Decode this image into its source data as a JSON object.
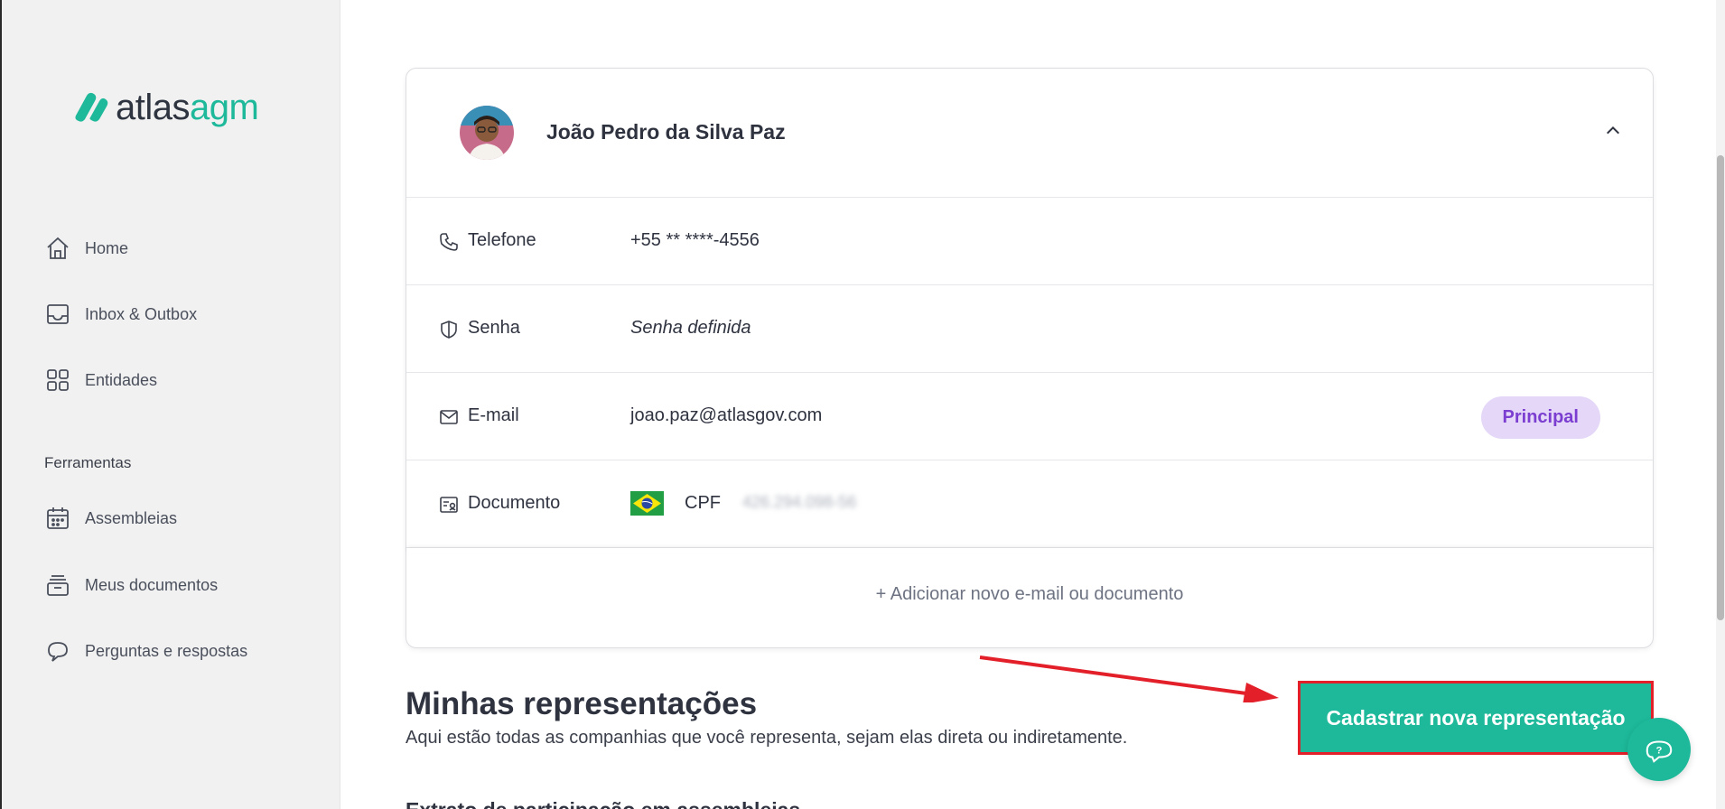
{
  "brand": {
    "word1": "atlas",
    "word2": "agm",
    "accent": "#1db99a"
  },
  "sidebar": {
    "items": [
      {
        "label": "Home",
        "icon": "home-icon"
      },
      {
        "label": "Inbox & Outbox",
        "icon": "inbox-icon"
      },
      {
        "label": "Entidades",
        "icon": "grid-icon"
      }
    ],
    "section_label": "Ferramentas",
    "tools": [
      {
        "label": "Assembleias",
        "icon": "calendar-icon"
      },
      {
        "label": "Meus documentos",
        "icon": "archive-icon"
      },
      {
        "label": "Perguntas e respostas",
        "icon": "chat-icon"
      }
    ]
  },
  "profile": {
    "name": "João Pedro da Silva Paz",
    "rows": {
      "phone": {
        "label": "Telefone",
        "value": "+55 ** ****-4556"
      },
      "password": {
        "label": "Senha",
        "value": "Senha definida"
      },
      "email": {
        "label": "E-mail",
        "value": "joao.paz@atlasgov.com",
        "badge": "Principal"
      },
      "document": {
        "label": "Documento",
        "type": "CPF",
        "value": "426.294.098-56"
      }
    },
    "add_link": "+ Adicionar novo e-mail ou documento"
  },
  "representations": {
    "title": "Minhas representações",
    "subtitle": "Aqui estão todas as companhias que você representa, sejam elas direta ou indiretamente.",
    "cta_label": "Cadastrar nova representação",
    "next_heading": "Extrato de participação em assembleias"
  },
  "colors": {
    "badge_bg": "#e4d7f8",
    "badge_text": "#7b3ed0",
    "annotation_red": "#e3202a"
  }
}
